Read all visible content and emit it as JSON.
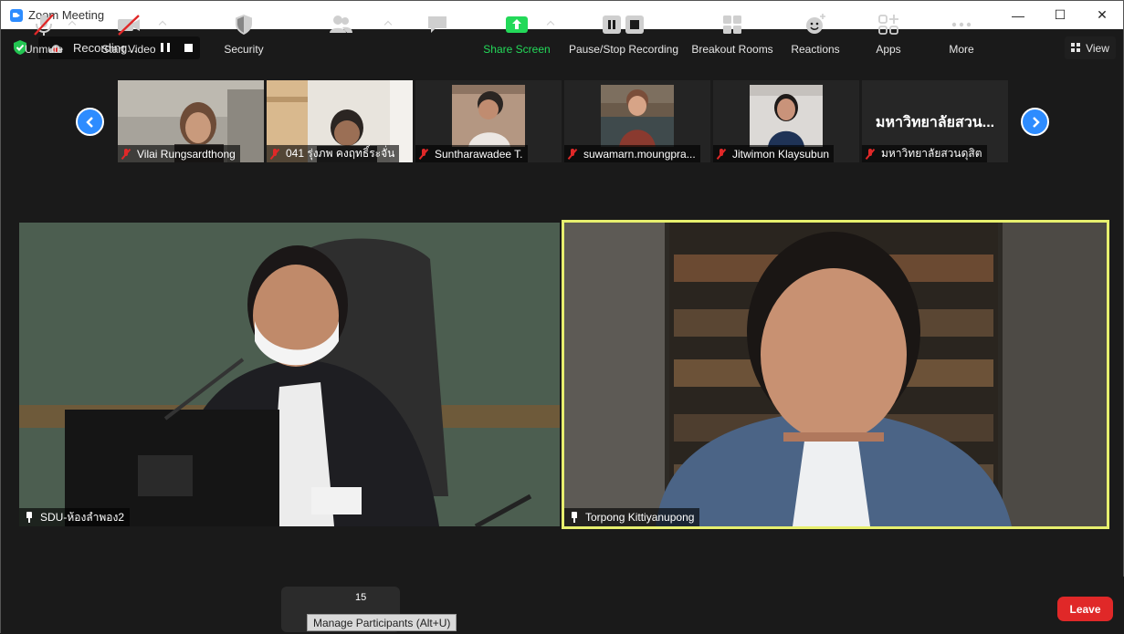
{
  "window": {
    "title": "Zoom Meeting",
    "controls": {
      "minimize": "—",
      "maximize": "☐",
      "close": "✕"
    }
  },
  "status": {
    "recording_label": "Recording...",
    "view_label": "View"
  },
  "thumbnails": [
    {
      "name": "Vilai Rungsardthong",
      "muted": true
    },
    {
      "name": "041 รุ่งภพ คงฤทธิ์ระจั่น",
      "muted": true
    },
    {
      "name": "Suntharawadee T.",
      "muted": true
    },
    {
      "name": "suwamarn.moungpra...",
      "muted": true
    },
    {
      "name": "Jitwimon Klaysubun",
      "muted": true
    },
    {
      "name": "มหาวิทยาลัยสวนดุสิต",
      "muted": true,
      "display_text": "มหาวิทยาลัยสวน..."
    }
  ],
  "main_videos": {
    "left": {
      "name": "SDU-ห้องลำพอง2"
    },
    "right": {
      "name": "Torpong Kittiyanupong",
      "active_speaker": true
    }
  },
  "toolbar": {
    "unmute": "Unmute",
    "start_video": "Start Video",
    "security": "Security",
    "participants_count": "15",
    "participants_tooltip": "Manage Participants (Alt+U)",
    "share_screen": "Share Screen",
    "pause_stop_recording": "Pause/Stop Recording",
    "breakout_rooms": "Breakout Rooms",
    "reactions": "Reactions",
    "apps": "Apps",
    "more": "More",
    "leave": "Leave"
  },
  "colors": {
    "accent": "#2d8cff",
    "leave": "#e02828",
    "share": "#23d959",
    "active_speaker_border": "#e7ef6e"
  }
}
